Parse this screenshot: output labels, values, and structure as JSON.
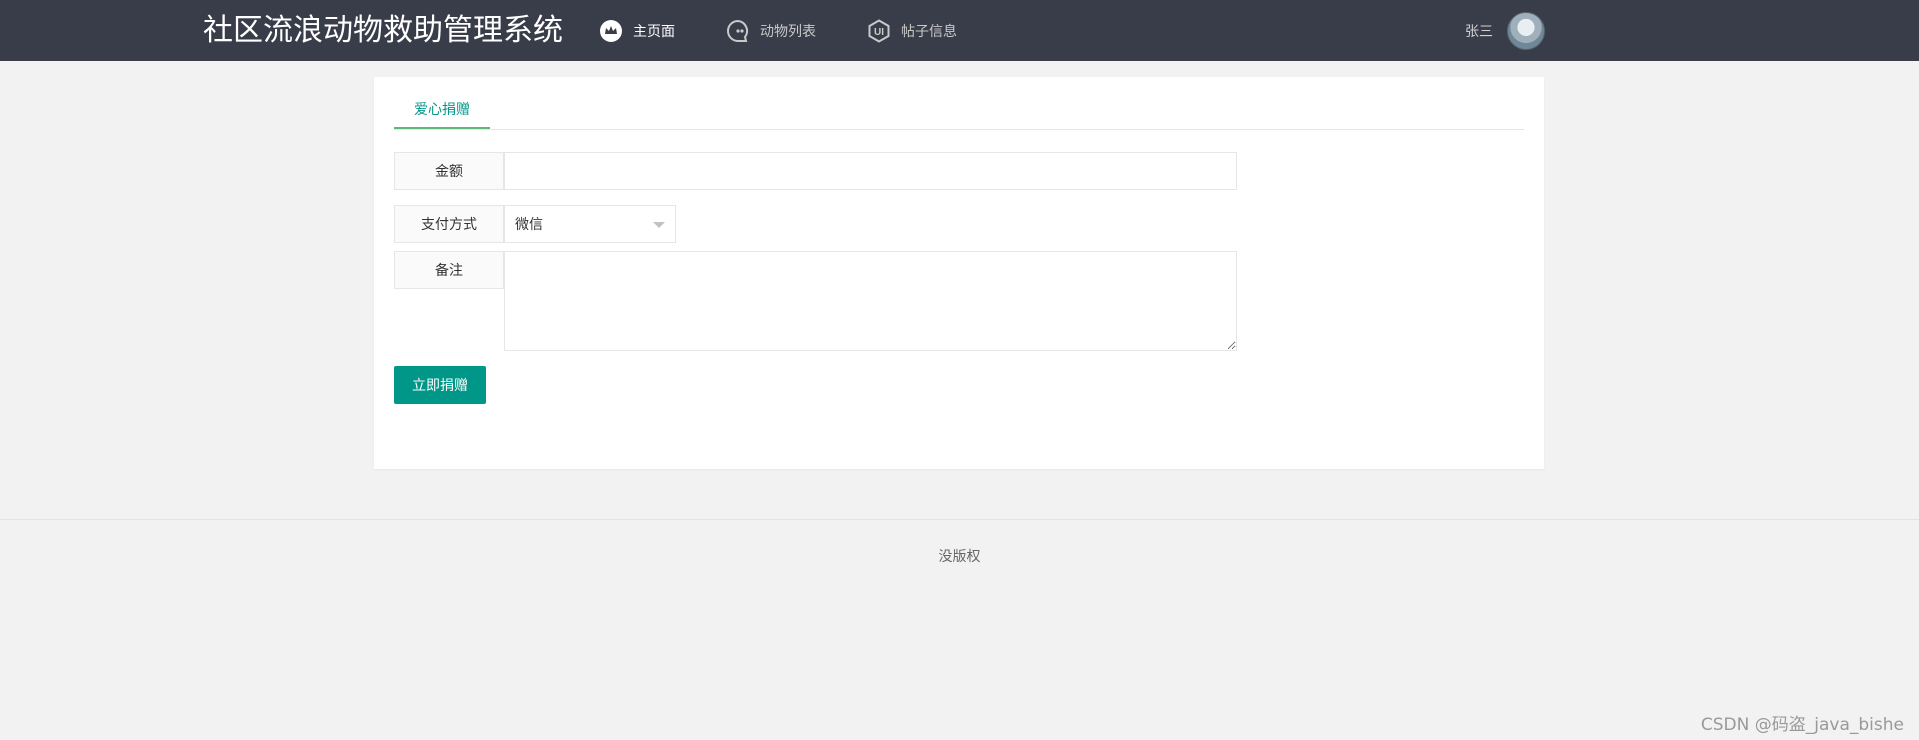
{
  "header": {
    "brand": "社区流浪动物救助管理系统",
    "nav": [
      {
        "label": "主页面",
        "icon": "crown-icon",
        "active": true
      },
      {
        "label": "动物列表",
        "icon": "chat-bubble-icon",
        "active": false
      },
      {
        "label": "帖子信息",
        "icon": "ui-hexagon-icon",
        "active": false
      }
    ],
    "user": {
      "name": "张三",
      "avatar": "user-avatar"
    }
  },
  "form": {
    "tab": "爱心捐赠",
    "amount_label": "金额",
    "amount_value": "",
    "payment_label": "支付方式",
    "payment_selected": "微信",
    "note_label": "备注",
    "note_value": "",
    "submit_label": "立即捐赠"
  },
  "footer": {
    "text": "没版权"
  },
  "watermark": "CSDN @码盗_java_bishe",
  "colors": {
    "header_bg": "#393d49",
    "accent": "#009688",
    "tab_underline": "#5FB878",
    "page_bg": "#f2f2f2"
  }
}
